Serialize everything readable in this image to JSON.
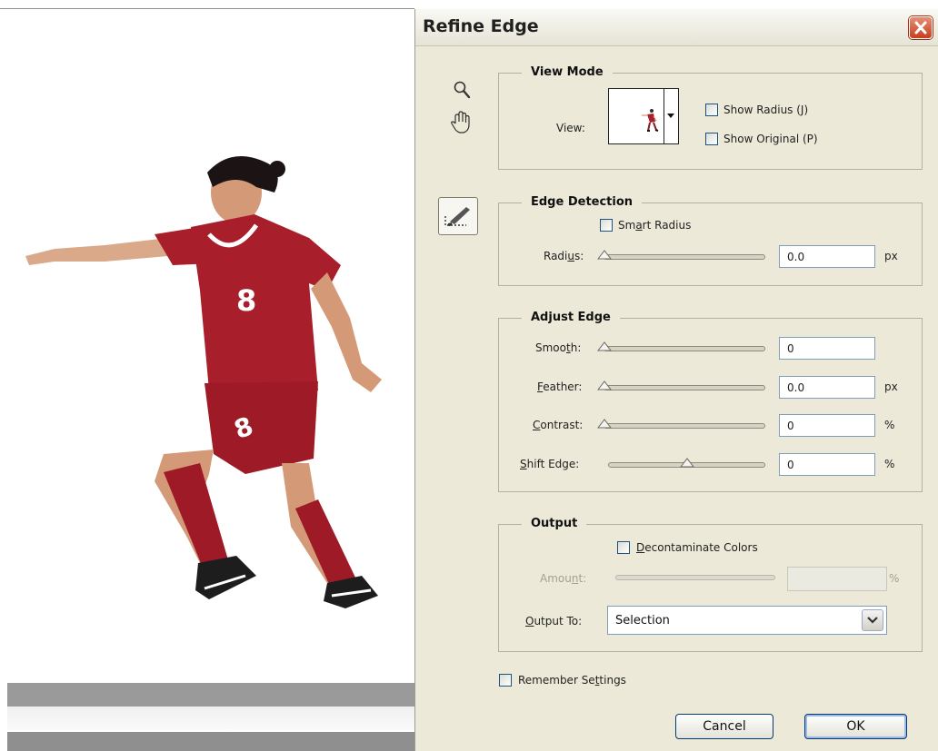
{
  "dialog": {
    "title": "Refine Edge",
    "close_icon": "close-icon",
    "tools": [
      "zoom-tool-icon",
      "hand-tool-icon",
      "refine-radius-tool-icon"
    ]
  },
  "view_mode": {
    "title": "View Mode",
    "view_label": "View:",
    "show_radius": {
      "label": "Show Radius (J)",
      "checked": false
    },
    "show_original": {
      "label": "Show Original (P)",
      "checked": false
    }
  },
  "edge_detection": {
    "title": "Edge Detection",
    "smart_radius": {
      "label_pre": "Sm",
      "label_key": "a",
      "label_post": "rt Radius",
      "checked": false
    },
    "radius": {
      "label_pre": "Radi",
      "label_key": "u",
      "label_post": "s:",
      "value": "0.0",
      "unit": "px",
      "slider_level": 0
    }
  },
  "adjust_edge": {
    "title": "Adjust Edge",
    "smooth": {
      "label_pre": "Smoo",
      "label_key": "t",
      "label_post": "h:",
      "value": "0",
      "unit": "",
      "slider_level": 0
    },
    "feather": {
      "label_pre": "",
      "label_key": "F",
      "label_post": "eather:",
      "value": "0.0",
      "unit": "px",
      "slider_level": 0
    },
    "contrast": {
      "label_pre": "",
      "label_key": "C",
      "label_post": "ontrast:",
      "value": "0",
      "unit": "%",
      "slider_level": 0
    },
    "shift_edge": {
      "label_pre": "",
      "label_key": "S",
      "label_post": "hift Edge:",
      "value": "0",
      "unit": "%",
      "slider_level": 0.5
    }
  },
  "output": {
    "title": "Output",
    "decontaminate": {
      "label_pre": "",
      "label_key": "D",
      "label_post": "econtaminate Colors",
      "checked": false
    },
    "amount": {
      "label_pre": "Amou",
      "label_key": "n",
      "label_post": "t:",
      "value": "",
      "unit": "%",
      "enabled": false
    },
    "output_to": {
      "label_pre": "",
      "label_key": "O",
      "label_post": "utput To:",
      "selected": "Selection"
    }
  },
  "remember": {
    "label_pre": "Remember Se",
    "label_key": "t",
    "label_post": "tings",
    "checked": false
  },
  "buttons": {
    "cancel": "Cancel",
    "ok": "OK"
  }
}
